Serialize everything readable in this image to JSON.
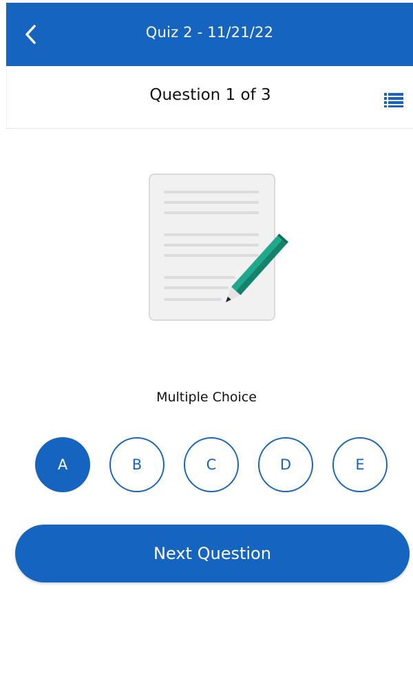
{
  "header": {
    "title": "Quiz 2 - 11/21/22",
    "back_icon": "chevron-left-icon"
  },
  "subheader": {
    "question_title": "Question 1 of 3",
    "list_icon": "list-icon"
  },
  "illustration": {
    "icon": "document-pencil-icon"
  },
  "question": {
    "type_label": "Multiple Choice",
    "choices": [
      "A",
      "B",
      "C",
      "D",
      "E"
    ],
    "selected": "A"
  },
  "actions": {
    "next_label": "Next Question"
  },
  "colors": {
    "primary": "#1565c0",
    "pencil": "#1aa58a",
    "paper": "#f1f1f2"
  }
}
